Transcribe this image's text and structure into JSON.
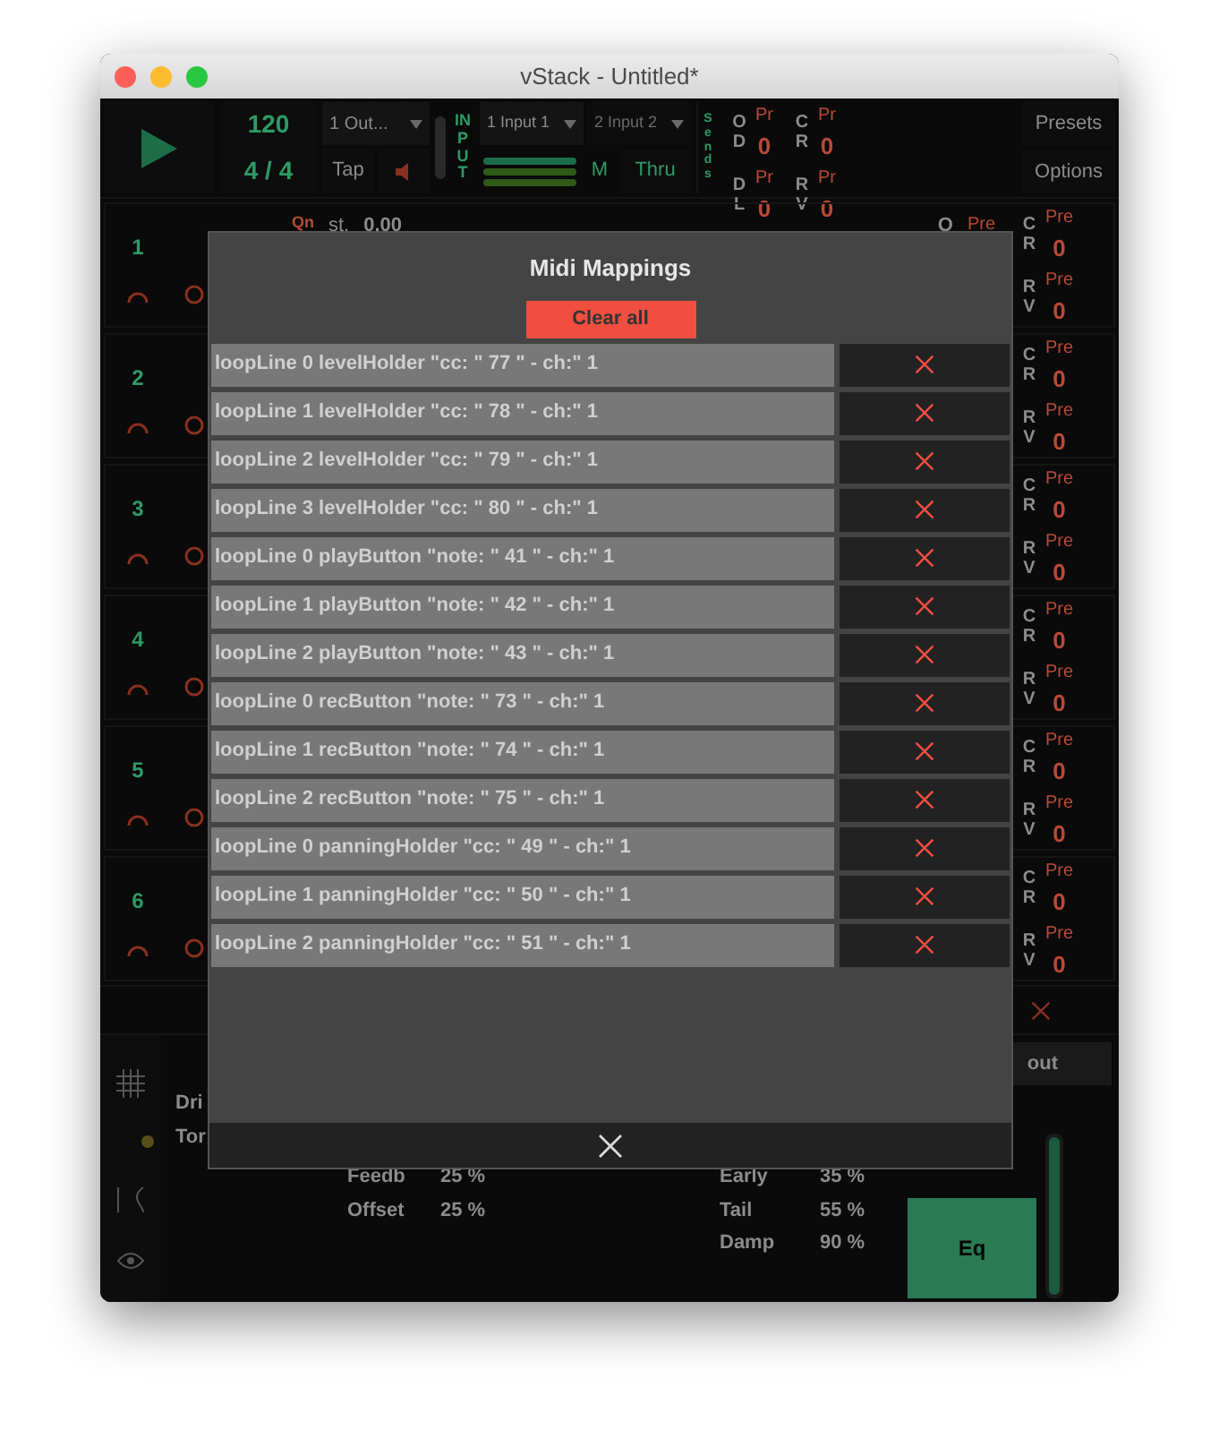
{
  "window": {
    "title": "vStack - Untitled*"
  },
  "toolbar": {
    "tempo": "120",
    "time_signature": "4 / 4",
    "output": "1 Out...",
    "tap": "Tap",
    "input_label": "INPUT",
    "inputs": [
      {
        "value": "1 Input 1",
        "disabled": false
      },
      {
        "value": "2 Input 2",
        "disabled": true
      }
    ],
    "monitor": "M",
    "thru": "Thru",
    "sends_label": "Sends",
    "sends": [
      {
        "label": "OD",
        "pre": "Pr",
        "value": "0"
      },
      {
        "label": "DL",
        "pre": "Pr",
        "value": "0"
      }
    ],
    "returns": [
      {
        "label": "CR",
        "pre": "Pr",
        "value": "0"
      },
      {
        "label": "RV",
        "pre": "Pr",
        "value": "0"
      }
    ],
    "presets": "Presets",
    "options": "Options"
  },
  "track_header": {
    "quantize": "Qn",
    "start_label": "st.",
    "start_value": "0.00",
    "output_label": "O",
    "pre": "Pre"
  },
  "tracks": [
    {
      "number": "1",
      "sends": [
        {
          "label": "CR",
          "pre": "Pre",
          "value": "0"
        },
        {
          "label": "RV",
          "pre": "Pre",
          "value": "0"
        }
      ]
    },
    {
      "number": "2",
      "sends": [
        {
          "label": "CR",
          "pre": "Pre",
          "value": "0"
        },
        {
          "label": "RV",
          "pre": "Pre",
          "value": "0"
        }
      ]
    },
    {
      "number": "3",
      "sends": [
        {
          "label": "CR",
          "pre": "Pre",
          "value": "0"
        },
        {
          "label": "RV",
          "pre": "Pre",
          "value": "0"
        }
      ]
    },
    {
      "number": "4",
      "sends": [
        {
          "label": "CR",
          "pre": "Pre",
          "value": "0"
        },
        {
          "label": "RV",
          "pre": "Pre",
          "value": "0"
        }
      ]
    },
    {
      "number": "5",
      "sends": [
        {
          "label": "CR",
          "pre": "Pre",
          "value": "0"
        },
        {
          "label": "RV",
          "pre": "Pre",
          "value": "0"
        }
      ]
    },
    {
      "number": "6",
      "sends": [
        {
          "label": "CR",
          "pre": "Pre",
          "value": "0"
        },
        {
          "label": "RV",
          "pre": "Pre",
          "value": "0"
        }
      ]
    }
  ],
  "bottom": {
    "out_button": "out",
    "effects": [
      "Dri",
      "Tor"
    ],
    "delay_params": [
      {
        "label": "Feedb",
        "value": "25 %"
      },
      {
        "label": "Offset",
        "value": "25 %"
      }
    ],
    "reverb_params": [
      {
        "label": "Early",
        "value": "35 %"
      },
      {
        "label": "Tail",
        "value": "55 %"
      },
      {
        "label": "Damp",
        "value": "90 %"
      }
    ],
    "eq": "Eq",
    "volume": {
      "level": 1
    }
  },
  "modal": {
    "title": "Midi Mappings",
    "clear_all": "Clear all",
    "mappings": [
      "loopLine 0 levelHolder \"cc: \" 77 \" - ch:\" 1",
      "loopLine 1 levelHolder \"cc: \" 78 \" - ch:\" 1",
      "loopLine 2 levelHolder \"cc: \" 79 \" - ch:\" 1",
      "loopLine 3 levelHolder \"cc: \" 80 \" - ch:\" 1",
      "loopLine 0 playButton \"note: \" 41 \" - ch:\" 1",
      "loopLine 1 playButton \"note: \" 42 \" - ch:\" 1",
      "loopLine 2 playButton \"note: \" 43 \" - ch:\" 1",
      "loopLine 0 recButton \"note: \" 73 \" - ch:\" 1",
      "loopLine 1 recButton \"note: \" 74 \" - ch:\" 1",
      "loopLine 2 recButton \"note: \" 75 \" - ch:\" 1",
      "loopLine 0 panningHolder \"cc: \" 49 \" - ch:\" 1",
      "loopLine 1 panningHolder \"cc: \" 50 \" - ch:\" 1",
      "loopLine 2 panningHolder \"cc: \" 51 \" - ch:\" 1"
    ]
  }
}
